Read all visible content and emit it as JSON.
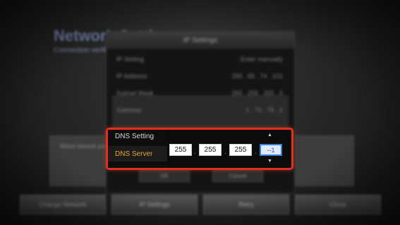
{
  "background": {
    "title": "Network Settings",
    "subtitle": "Connection verification…",
    "wired_text": "Wired network and…",
    "buttons": [
      "Change Network",
      "IP Settings",
      "Retry",
      "Close"
    ]
  },
  "dialog": {
    "title": "IP Settings",
    "rows": [
      {
        "label": "IP Setting",
        "value": "Enter manually"
      },
      {
        "label": "IP Address",
        "value": "255 . 65 . 74 . 101"
      },
      {
        "label": "Subnet Mask",
        "value": "255 . 255 . 255 . 0"
      },
      {
        "label": "Gateway",
        "value": "1 . 71 . 76 . 1"
      }
    ],
    "ok_label": "OK",
    "cancel_label": "Cancel"
  },
  "dns": {
    "setting_label": "DNS Setting",
    "server_label": "DNS Server",
    "octets": [
      "255",
      "255",
      "255",
      "--1"
    ],
    "active_octet": 3
  },
  "colors": {
    "highlight_border": "#e0301e",
    "selected_label": "#e8a733"
  }
}
